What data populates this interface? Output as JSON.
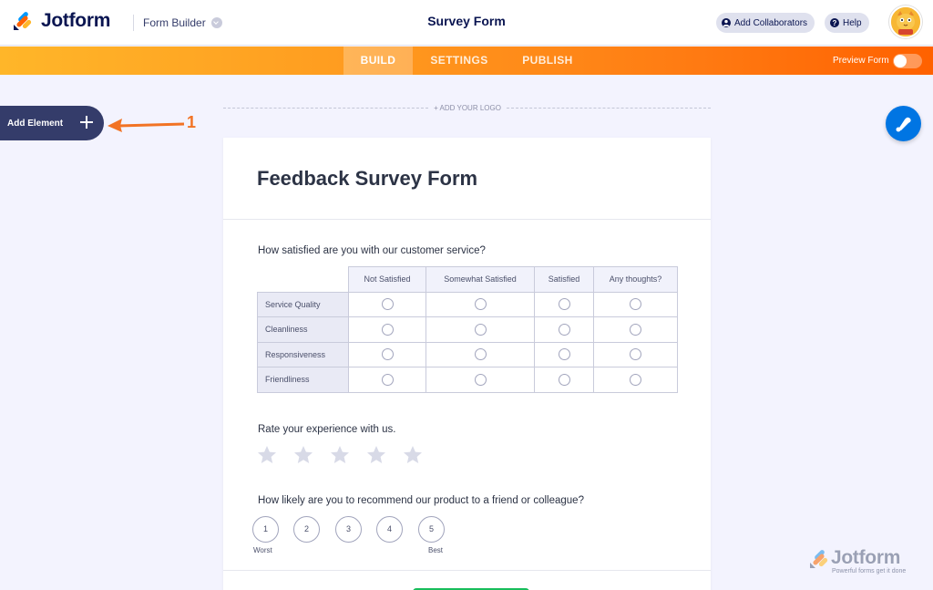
{
  "header": {
    "brand": "Jotform",
    "builder_label": "Form Builder",
    "form_title": "Survey Form",
    "collaborators_label": "Add Collaborators",
    "help_label": "Help"
  },
  "nav": {
    "tabs": [
      {
        "label": "BUILD",
        "active": true
      },
      {
        "label": "SETTINGS",
        "active": false
      },
      {
        "label": "PUBLISH",
        "active": false
      }
    ],
    "preview_label": "Preview Form",
    "preview_on": false
  },
  "sidebar": {
    "add_element_label": "Add Element",
    "annotation_number": "1"
  },
  "form": {
    "logo_placeholder": "+ ADD YOUR LOGO",
    "title": "Feedback Survey Form",
    "q1": {
      "label": "How satisfied are you with our customer service?",
      "columns": [
        "Not Satisfied",
        "Somewhat Satisfied",
        "Satisfied",
        "Any thoughts?"
      ],
      "rows": [
        "Service Quality",
        "Cleanliness",
        "Responsiveness",
        "Friendliness"
      ]
    },
    "q2": {
      "label": "Rate your experience with us.",
      "stars": 5,
      "selected": 0
    },
    "q3": {
      "label": "How likely are you to recommend our product to a friend or colleague?",
      "options": [
        "1",
        "2",
        "3",
        "4",
        "5"
      ],
      "low_label": "Worst",
      "high_label": "Best"
    }
  },
  "watermark": {
    "brand": "Jotform",
    "tagline": "Powerful forms get it done"
  },
  "colors": {
    "accent": "#ff6100",
    "navy": "#0a1551",
    "fab_blue": "#0075e3",
    "submit_green": "#18bd5b"
  }
}
